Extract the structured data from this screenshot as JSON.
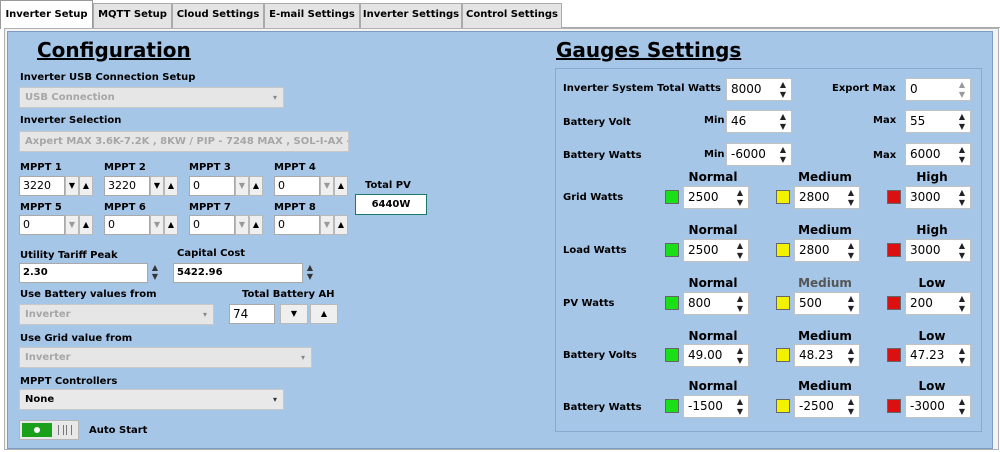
{
  "tabs": [
    "Inverter Setup",
    "MQTT Setup",
    "Cloud Settings",
    "E-mail Settings",
    "Inverter Settings",
    "Control Settings"
  ],
  "config": {
    "title": "Configuration",
    "usb_label": "Inverter USB Connection Setup",
    "usb_value": "USB Connection",
    "inverter_label": "Inverter Selection",
    "inverter_value": "Axpert MAX 3.6K-7.2K , 8KW / PIP - 7248 MAX , SOL-I-AX -",
    "mppt": [
      {
        "label": "MPPT 1",
        "value": "3220"
      },
      {
        "label": "MPPT 2",
        "value": "3220"
      },
      {
        "label": "MPPT 3",
        "value": "0"
      },
      {
        "label": "MPPT 4",
        "value": "0"
      },
      {
        "label": "MPPT 5",
        "value": "0"
      },
      {
        "label": "MPPT 6",
        "value": "0"
      },
      {
        "label": "MPPT 7",
        "value": "0"
      },
      {
        "label": "MPPT 8",
        "value": "0"
      }
    ],
    "total_pv_label": "Total PV",
    "total_pv_value": "6440W",
    "tariff_label": "Utility Tariff Peak",
    "tariff_value": "2.30",
    "capital_label": "Capital Cost",
    "capital_value": "5422.96",
    "battery_from_label": "Use Battery values from",
    "battery_from_value": "Inverter",
    "total_ah_label": "Total Battery AH",
    "total_ah_value": "74",
    "grid_from_label": "Use Grid value from",
    "grid_from_value": "Inverter",
    "mppt_ctrl_label": "MPPT Controllers",
    "mppt_ctrl_value": "None",
    "auto_start_label": "Auto Start"
  },
  "gauges": {
    "title": "Gauges Settings",
    "inv_total_label": "Inverter System Total Watts",
    "inv_total_value": "8000",
    "export_label": "Export Max",
    "export_value": "0",
    "battery_volt_label": "Battery Volt",
    "battery_watts_label": "Battery Watts",
    "min_label": "Min",
    "max_label": "Max",
    "bv_min": "46",
    "bv_max": "55",
    "bw_min": "-6000",
    "bw_max": "6000",
    "rows": [
      {
        "label": "Grid Watts",
        "h1": "Normal",
        "h2": "Medium",
        "h3": "High",
        "v1": "2500",
        "v2": "2800",
        "v3": "3000"
      },
      {
        "label": "Load Watts",
        "h1": "Normal",
        "h2": "Medium",
        "h3": "High",
        "v1": "2500",
        "v2": "2800",
        "v3": "3000"
      },
      {
        "label": "PV Watts",
        "h1": "Normal",
        "h2": "Medium",
        "h3": "Low",
        "v1": "800",
        "v2": "500",
        "v3": "200"
      },
      {
        "label": "Battery Volts",
        "h1": "Normal",
        "h2": "Medium",
        "h3": "Low",
        "v1": "49.00",
        "v2": "48.23",
        "v3": "47.23"
      },
      {
        "label": "Battery Watts",
        "h1": "Normal",
        "h2": "Medium",
        "h3": "Low",
        "v1": "-1500",
        "v2": "-2500",
        "v3": "-3000"
      }
    ]
  },
  "colors": {
    "normal": "#19e019",
    "medium": "#f2f200",
    "high": "#dd1010",
    "panel": "#a6c6e8"
  }
}
